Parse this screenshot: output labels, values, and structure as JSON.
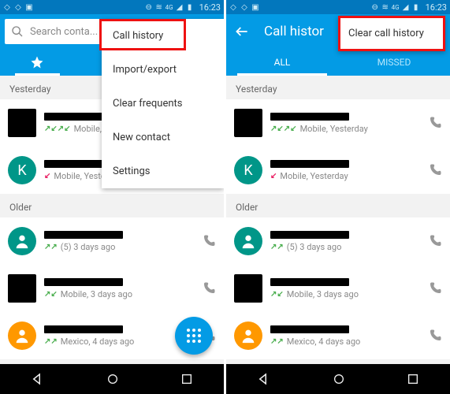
{
  "status": {
    "time": "16:23",
    "signal_label": "4G"
  },
  "left_screen": {
    "search_placeholder": "Search conta...",
    "menu_items": [
      "Call history",
      "Import/export",
      "Clear frequents",
      "New contact",
      "Settings"
    ],
    "sections": [
      {
        "label": "Yesterday",
        "rows": [
          {
            "avatar_type": "square",
            "arrows": [
              "out",
              "in",
              "out",
              "in"
            ],
            "meta_suffix": "Mobile, Yesterday"
          },
          {
            "avatar_type": "teal",
            "avatar_letter": "K",
            "arrows": [
              "miss"
            ],
            "meta_suffix": "Mobile, Yesterday"
          }
        ]
      },
      {
        "label": "Older",
        "rows": [
          {
            "avatar_type": "teal",
            "avatar_person": true,
            "arrows": [
              "out",
              "out"
            ],
            "meta_prefix": "(5)",
            "meta_suffix": "3 days ago"
          },
          {
            "avatar_type": "square",
            "arrows": [
              "out",
              "in"
            ],
            "meta_suffix": "Mobile, 3 days ago"
          },
          {
            "avatar_type": "orange",
            "avatar_person": true,
            "arrows": [
              "out",
              "out"
            ],
            "meta_suffix": "Mexico, 4 days ago"
          }
        ]
      }
    ]
  },
  "right_screen": {
    "header_title": "Call histor",
    "menu_label": "Clear call history",
    "tabs": [
      "ALL",
      "MISSED"
    ],
    "active_tab": 0,
    "sections": [
      {
        "label": "Yesterday",
        "rows": [
          {
            "avatar_type": "square",
            "arrows": [
              "out",
              "in",
              "out",
              "in"
            ],
            "meta_suffix": "Mobile, Yesterday"
          },
          {
            "avatar_type": "teal",
            "avatar_letter": "K",
            "arrows": [
              "miss"
            ],
            "meta_suffix": "Mobile, Yesterday"
          }
        ]
      },
      {
        "label": "Older",
        "rows": [
          {
            "avatar_type": "teal",
            "avatar_person": true,
            "arrows": [
              "out",
              "out"
            ],
            "meta_prefix": "(5)",
            "meta_suffix": "3 days ago"
          },
          {
            "avatar_type": "square",
            "arrows": [
              "out",
              "in"
            ],
            "meta_suffix": "Mobile, 3 days ago"
          },
          {
            "avatar_type": "orange",
            "avatar_person": true,
            "arrows": [
              "out",
              "out"
            ],
            "meta_suffix": "Mexico, 4 days ago"
          }
        ]
      }
    ]
  }
}
